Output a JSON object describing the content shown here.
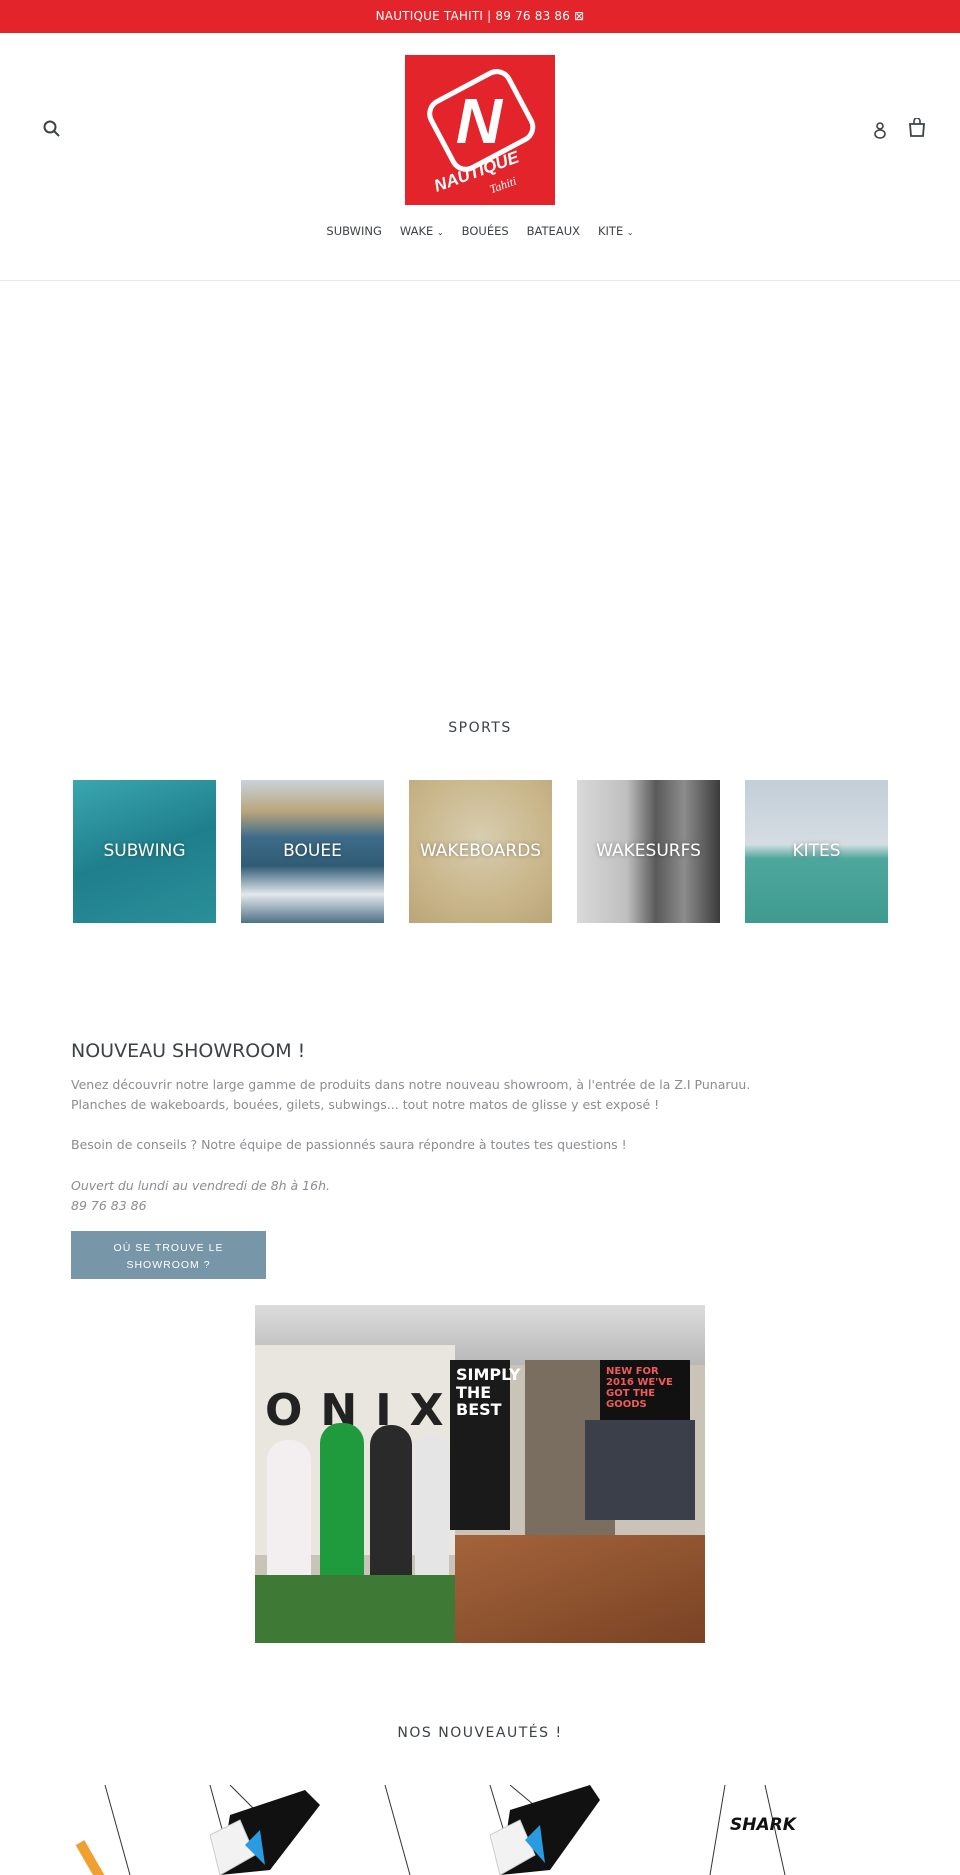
{
  "announcement": "NAUTIQUE TAHITI | 89 76 83 86 ⊠",
  "logo": {
    "text": "NAUTIQUE",
    "sub": "Tahiti",
    "color": "#e3242b"
  },
  "header_icons": [
    "search-icon",
    "account-icon",
    "cart-icon"
  ],
  "nav": [
    {
      "label": "SUBWING"
    },
    {
      "label": "WAKE",
      "dropdown": true
    },
    {
      "label": "BOUÉES"
    },
    {
      "label": "BATEAUX"
    },
    {
      "label": "KITE",
      "dropdown": true
    }
  ],
  "sports": {
    "title": "SPORTS",
    "tiles": [
      {
        "label": "SUBWING"
      },
      {
        "label": "BOUEE"
      },
      {
        "label": "WAKEBOARDS"
      },
      {
        "label": "WAKESURFS"
      },
      {
        "label": "KITES"
      }
    ]
  },
  "showroom": {
    "title": "NOUVEAU SHOWROOM !",
    "line1": "Venez découvrir notre large gamme de produits dans notre nouveau showroom, à l'entrée de la Z.I Punaruu.",
    "line2": "Planches de wakeboards, bouées, gilets, subwings... tout notre matos de glisse y est exposé !",
    "line3": "Besoin de conseils ? Notre équipe de passionnés saura répondre à toutes tes questions !",
    "hours": "Ouvert du lundi au vendredi de 8h à 16h.",
    "phone": "89 76 83 86",
    "button": "OÙ SE TROUVE LE SHOWROOM ?",
    "button_color": "#7796a8",
    "photo_text": {
      "brand": "ONIX",
      "poster1": "SIMPLY THE BEST",
      "poster2": "NEW FOR 2016 WE'VE GOT THE GOODS"
    }
  },
  "new_products": {
    "title": "NOS NOUVEAUTÉS !",
    "product3_logo": "SHARK"
  }
}
